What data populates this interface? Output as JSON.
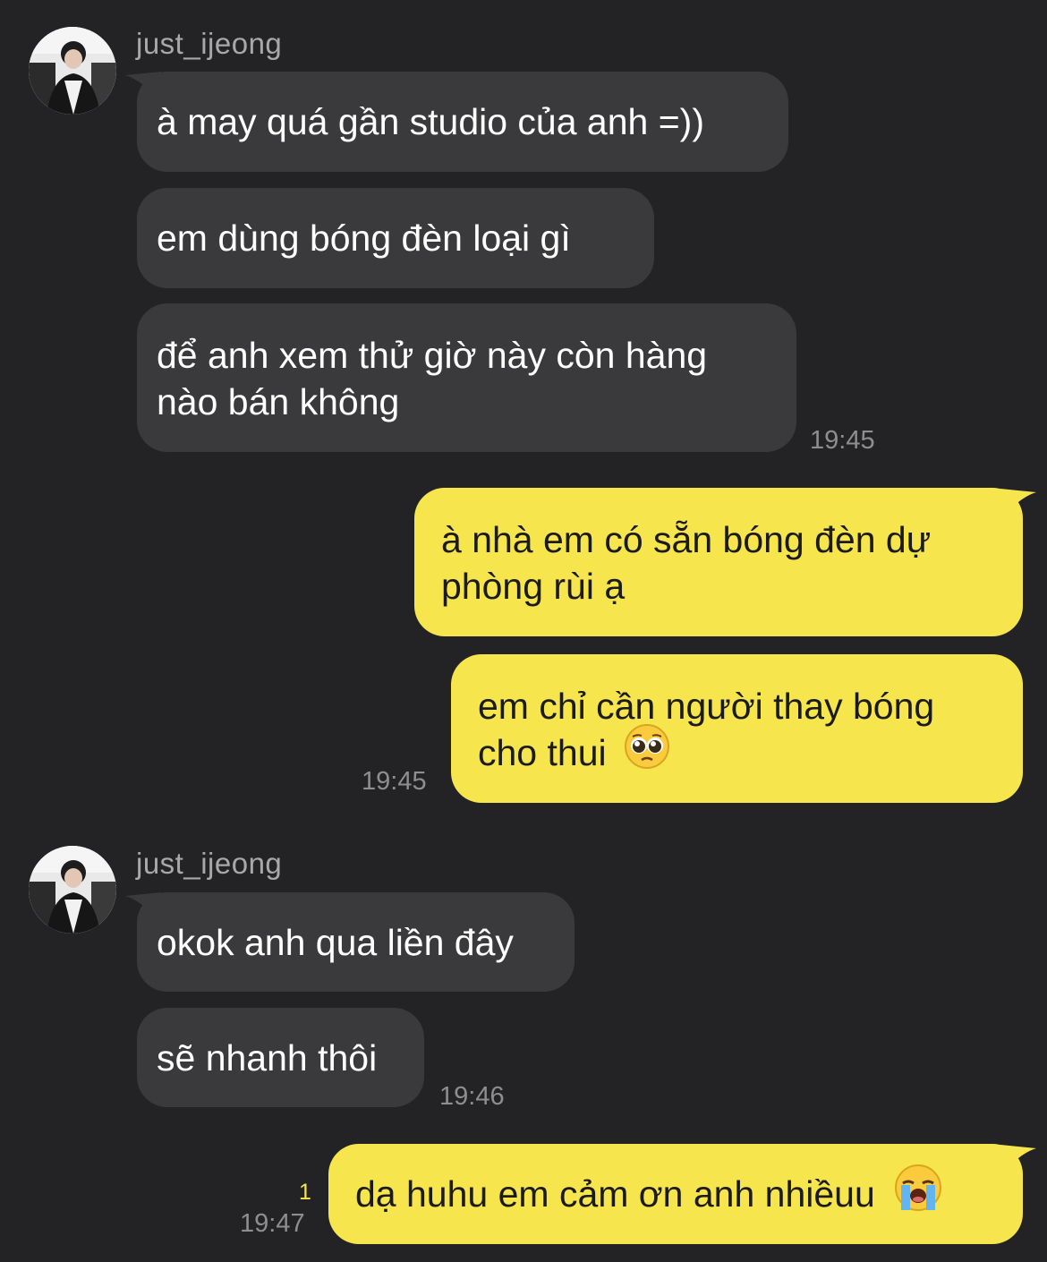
{
  "conversation": {
    "groups": [
      {
        "sender": "just_ijeong",
        "messages": [
          "à may quá gần studio của anh =))",
          "em dùng bóng đèn loại gì",
          "để anh xem thử giờ này còn hàng nào bán không"
        ],
        "time": "19:45"
      },
      {
        "sender": "me",
        "messages": [
          "à nhà em có sẵn bóng đèn dự phòng rùi ạ",
          "em chỉ cần người thay bóng cho thui"
        ],
        "time": "19:45",
        "emoji": "pleading-face-emoji"
      },
      {
        "sender": "just_ijeong",
        "messages": [
          "okok anh qua liền đây",
          "sẽ nhanh thôi"
        ],
        "time": "19:46"
      },
      {
        "sender": "me",
        "messages": [
          "dạ huhu em cảm ơn anh nhiềuu"
        ],
        "time": "19:47",
        "unread_count": "1",
        "emoji": "loudly-crying-face-emoji"
      }
    ]
  },
  "colors": {
    "background": "#232325",
    "incoming_bubble": "#3a3a3c",
    "outgoing_bubble": "#f7e54e",
    "timestamp": "#8e8e91",
    "unread": "#f7e54e"
  }
}
